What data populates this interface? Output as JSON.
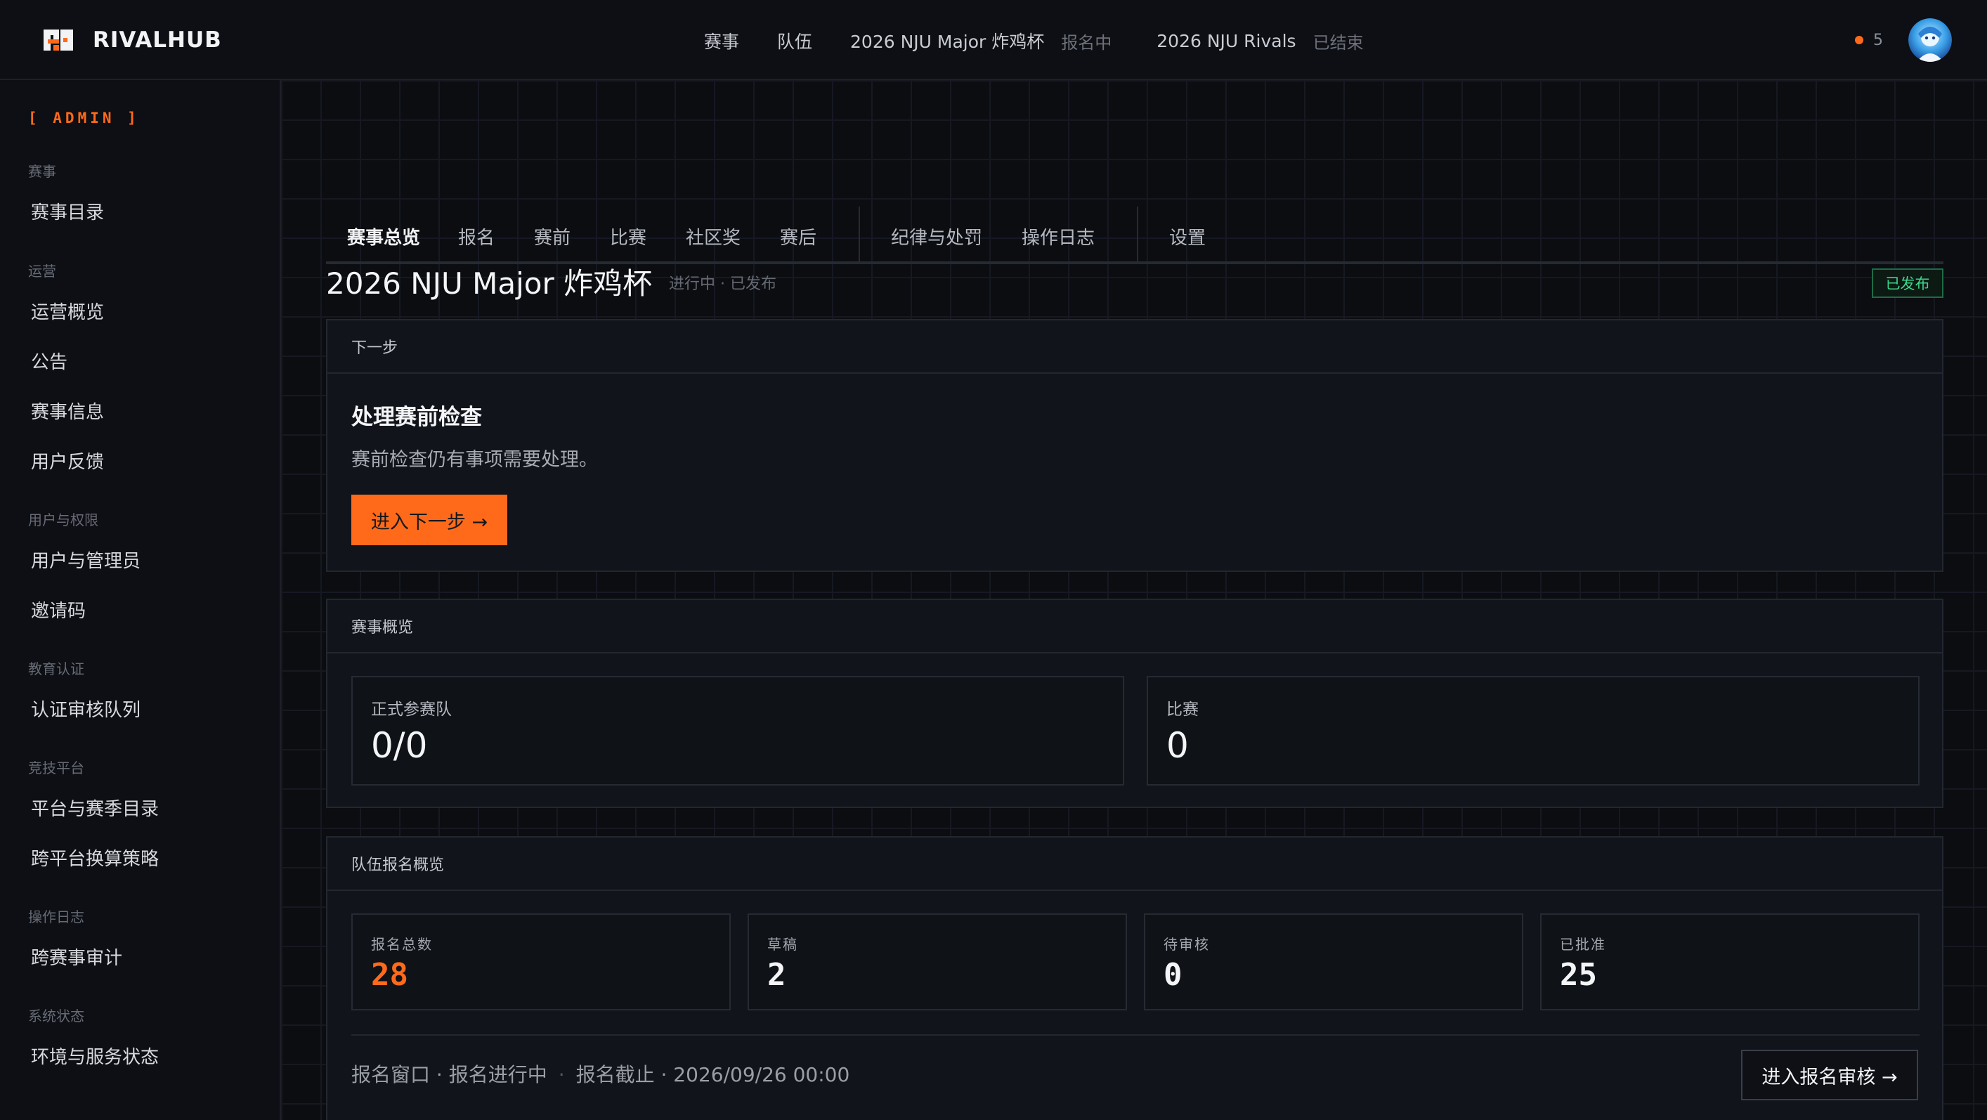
{
  "brand": {
    "name": "RIVALHUB"
  },
  "topnav": {
    "items": [
      "赛事",
      "队伍"
    ],
    "events": [
      {
        "name": "2026 NJU Major 炸鸡杯",
        "status": "报名中"
      },
      {
        "name": "2026 NJU Rivals",
        "status": "已结束"
      }
    ],
    "notification_count": "5"
  },
  "sidebar": {
    "admin_tag": "[ ADMIN ]",
    "groups": [
      {
        "label": "赛事",
        "items": [
          "赛事目录"
        ]
      },
      {
        "label": "运营",
        "items": [
          "运营概览",
          "公告",
          "赛事信息",
          "用户反馈"
        ]
      },
      {
        "label": "用户与权限",
        "items": [
          "用户与管理员",
          "邀请码"
        ]
      },
      {
        "label": "教育认证",
        "items": [
          "认证审核队列"
        ]
      },
      {
        "label": "竞技平台",
        "items": [
          "平台与赛季目录",
          "跨平台换算策略"
        ]
      },
      {
        "label": "操作日志",
        "items": [
          "跨赛事审计"
        ]
      },
      {
        "label": "系统状态",
        "items": [
          "环境与服务状态"
        ]
      }
    ]
  },
  "tabs": [
    "赛事总览",
    "报名",
    "赛前",
    "比赛",
    "社区奖",
    "赛后",
    "纪律与处罚",
    "操作日志",
    "设置"
  ],
  "page": {
    "title": "2026 NJU Major 炸鸡杯",
    "status_line": "进行中 · 已发布",
    "badge": "已发布"
  },
  "next_step": {
    "header": "下一步",
    "title": "处理赛前检查",
    "desc": "赛前检查仍有事项需要处理。",
    "button": "进入下一步 →"
  },
  "overview": {
    "header": "赛事概览",
    "stats": [
      {
        "label": "正式参赛队",
        "value": "0/0"
      },
      {
        "label": "比赛",
        "value": "0"
      }
    ]
  },
  "registration": {
    "header": "队伍报名概览",
    "stats": [
      {
        "label": "报名总数",
        "value": "28"
      },
      {
        "label": "草稿",
        "value": "2"
      },
      {
        "label": "待审核",
        "value": "0"
      },
      {
        "label": "已批准",
        "value": "25"
      }
    ],
    "window": "报名窗口 · 报名进行中",
    "deadline": "报名截止 · 2026/09/26 00:00",
    "button": "进入报名审核 →"
  },
  "colors": {
    "accent": "#ff6a1a",
    "success": "#3fd68a"
  }
}
